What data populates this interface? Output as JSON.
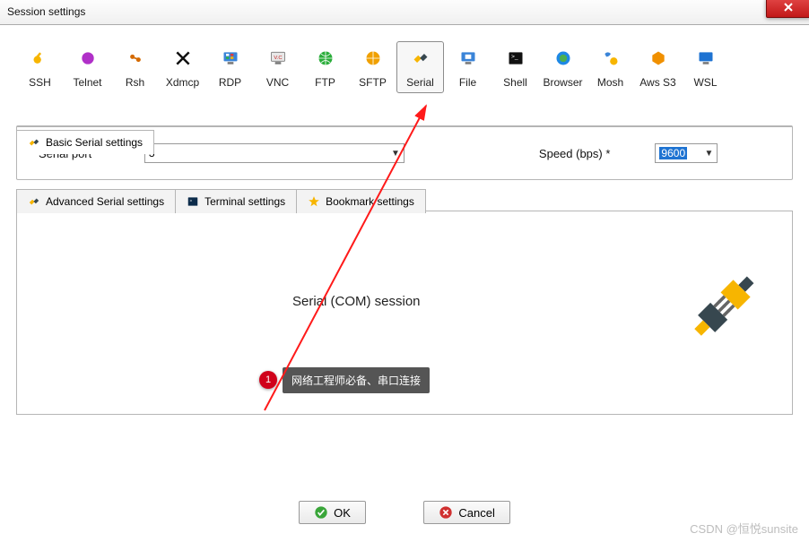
{
  "window": {
    "title": "Session settings"
  },
  "toolbar": {
    "items": [
      {
        "id": "ssh",
        "label": "SSH"
      },
      {
        "id": "telnet",
        "label": "Telnet"
      },
      {
        "id": "rsh",
        "label": "Rsh"
      },
      {
        "id": "xdmcp",
        "label": "Xdmcp"
      },
      {
        "id": "rdp",
        "label": "RDP"
      },
      {
        "id": "vnc",
        "label": "VNC"
      },
      {
        "id": "ftp",
        "label": "FTP"
      },
      {
        "id": "sftp",
        "label": "SFTP"
      },
      {
        "id": "serial",
        "label": "Serial"
      },
      {
        "id": "file",
        "label": "File"
      },
      {
        "id": "shell",
        "label": "Shell"
      },
      {
        "id": "browser",
        "label": "Browser"
      },
      {
        "id": "mosh",
        "label": "Mosh"
      },
      {
        "id": "awss3",
        "label": "Aws S3"
      },
      {
        "id": "wsl",
        "label": "WSL"
      }
    ]
  },
  "basic_tab": {
    "label": "Basic Serial settings",
    "port_label": "Serial port *",
    "port_value": "3",
    "speed_label": "Speed (bps) *",
    "speed_value": "9600"
  },
  "secondary_tabs": {
    "advanced": "Advanced Serial settings",
    "terminal": "Terminal settings",
    "bookmark": "Bookmark settings"
  },
  "main": {
    "session_label": "Serial (COM) session"
  },
  "annotation": {
    "badge": "1",
    "tip": "网络工程师必备、串口连接"
  },
  "buttons": {
    "ok": "OK",
    "cancel": "Cancel"
  },
  "watermark": "CSDN @恒悦sunsite"
}
